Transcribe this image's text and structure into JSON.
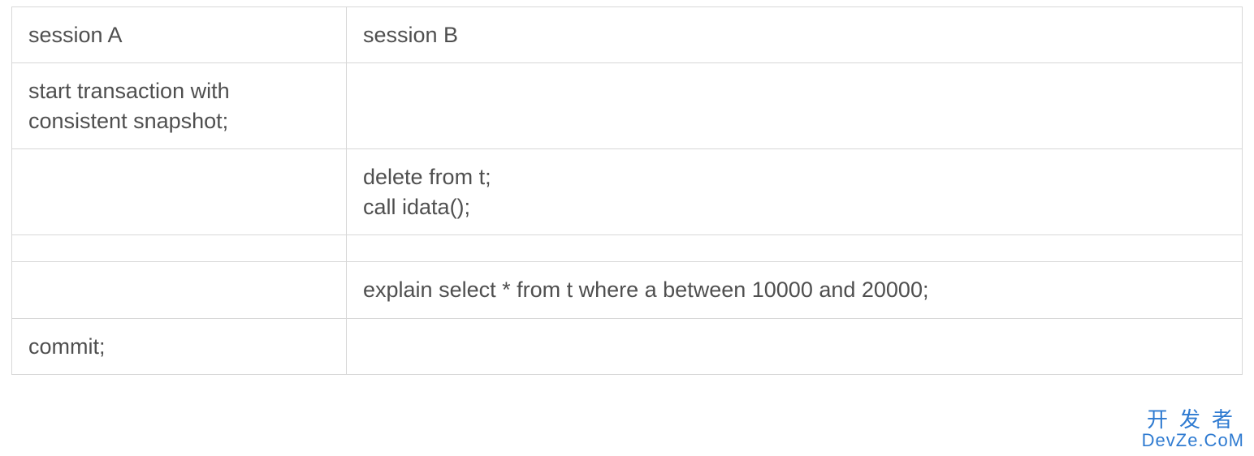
{
  "table": {
    "headers": [
      "session A",
      "session B"
    ],
    "rows": [
      [
        "start transaction with consistent snapshot;",
        ""
      ],
      [
        "",
        "delete from t;\ncall idata();"
      ],
      [
        "",
        ""
      ],
      [
        "",
        "explain select * from t where a between 10000 and 20000;"
      ],
      [
        "commit;",
        ""
      ]
    ]
  },
  "watermark": {
    "line1": "开发者",
    "line2": "DevZe.CoM"
  }
}
